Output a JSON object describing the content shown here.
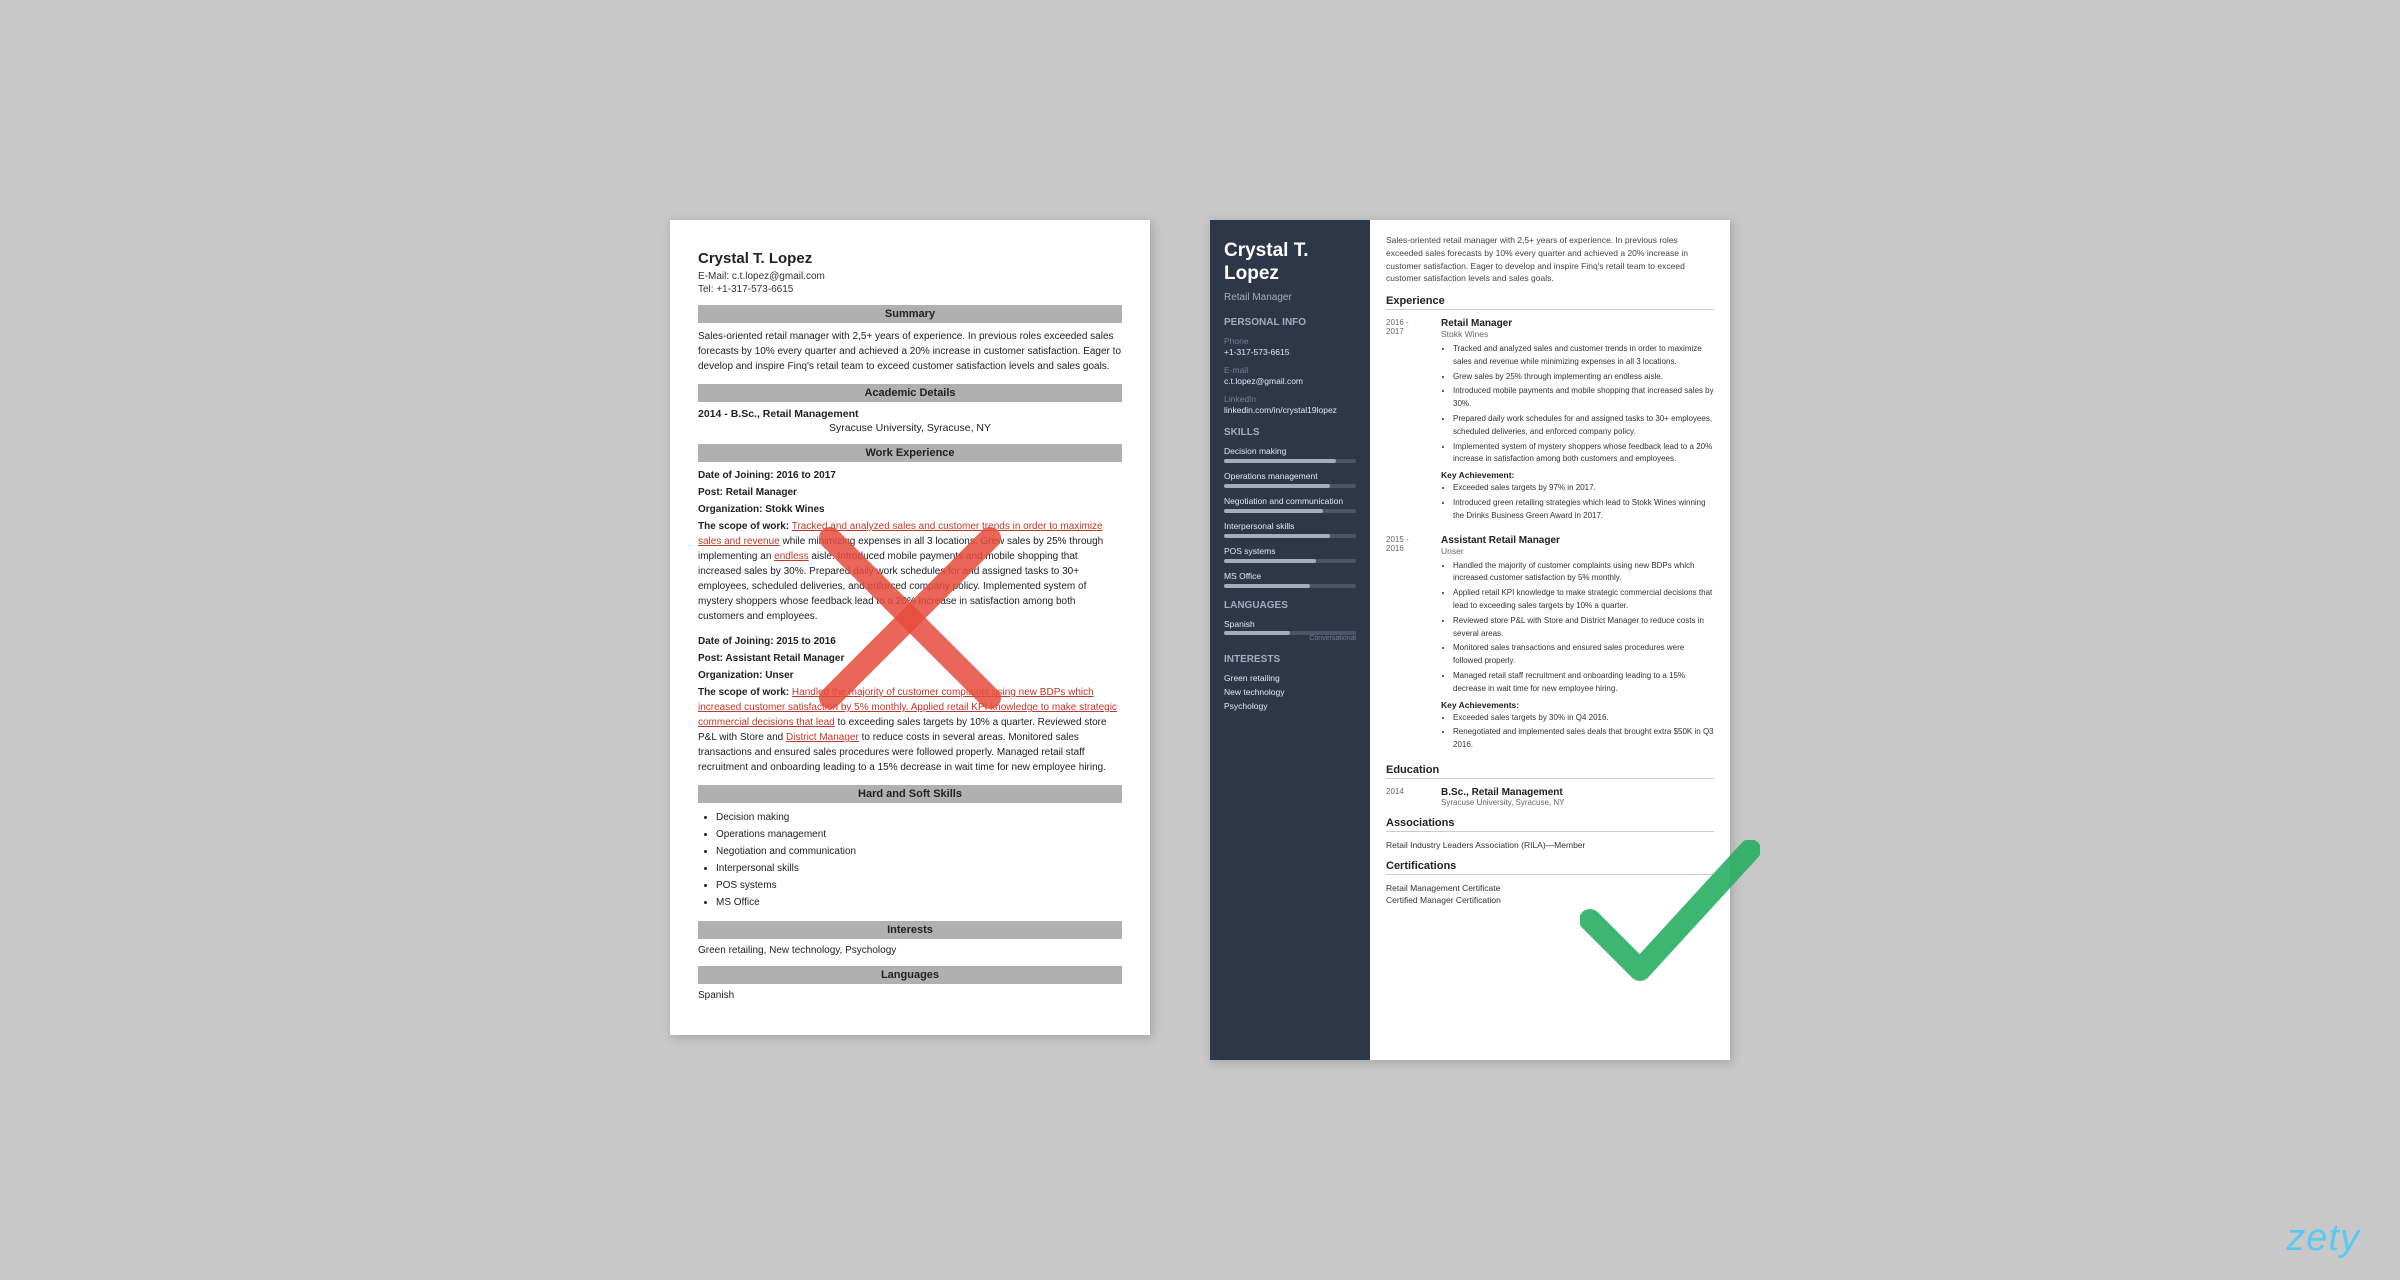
{
  "left_resume": {
    "name": "Crystal T. Lopez",
    "email_label": "E-Mail:",
    "email": "c.t.lopez@gmail.com",
    "tel_label": "Tel:",
    "tel": "+1-317-573-6615",
    "sections": {
      "summary": {
        "title": "Summary",
        "text": "Sales-oriented retail manager with 2,5+ years of experience. In previous roles exceeded sales forecasts by 10% every quarter and achieved a 20% increase in customer satisfaction. Eager to develop and inspire Finq's retail team to exceed customer satisfaction levels and sales goals."
      },
      "academic": {
        "title": "Academic Details",
        "degree": "2014 - B.Sc., Retail Management",
        "school": "Syracuse University, Syracuse, NY"
      },
      "work": {
        "title": "Work Experience",
        "jobs": [
          {
            "dates": "Date of Joining: 2016 to 2017",
            "post": "Post: Retail Manager",
            "org": "Organization: Stokk Wines",
            "scope_label": "The scope of work:",
            "scope": "Tracked and analyzed sales and customer trends in order to maximize sales and revenue while minimizing expenses in all 3 locations. Grew sales by 25% through implementing an endless aisle. Introduced mobile payments and mobile shopping that increased sales by 30%. Prepared daily work schedules for and assigned tasks to 30+ employees, scheduled deliveries, and enforced company policy. Implemented system of mystery shoppers whose feedback lead to a 20% increase in satisfaction among both customers and employees."
          },
          {
            "dates": "Date of Joining: 2015 to 2016",
            "post": "Post: Assistant Retail Manager",
            "org": "Organization: Unser",
            "scope_label": "The scope of work:",
            "scope": "Handled the majority of customer complaints using new BDPs which increased customer satisfaction by 5% monthly. Applied retail KPI knowledge to make strategic commercial decisions that lead to exceeding sales targets by 10% a quarter. Reviewed store P&L with Store and District Manager to reduce costs in several areas. Monitored sales transactions and ensured sales procedures were followed properly. Managed retail staff recruitment and onboarding leading to a 15% decrease in wait time for new employee hiring."
          }
        ]
      },
      "skills": {
        "title": "Hard and Soft Skills",
        "items": [
          "Decision making",
          "Operations management",
          "Negotiation and communication",
          "Interpersonal skills",
          "POS systems",
          "MS Office"
        ]
      },
      "interests": {
        "title": "Interests",
        "text": "Green retailing, New technology, Psychology"
      },
      "languages": {
        "title": "Languages",
        "text": "Spanish"
      }
    }
  },
  "right_resume": {
    "name_line1": "Crystal T.",
    "name_line2": "Lopez",
    "title": "Retail Manager",
    "sidebar": {
      "personal_info_title": "Personal Info",
      "phone_label": "Phone",
      "phone": "+1-317-573-6615",
      "email_label": "E-mail",
      "email": "c.t.lopez@gmail.com",
      "linkedin_label": "LinkedIn",
      "linkedin": "linkedin.com/in/crystal19lopez",
      "skills_title": "Skills",
      "skills": [
        {
          "name": "Decision making",
          "pct": 85
        },
        {
          "name": "Operations management",
          "pct": 80
        },
        {
          "name": "Negotiation and communication",
          "pct": 75
        },
        {
          "name": "Interpersonal skills",
          "pct": 80
        },
        {
          "name": "POS systems",
          "pct": 70
        },
        {
          "name": "MS Office",
          "pct": 65
        }
      ],
      "languages_title": "Languages",
      "languages": [
        {
          "name": "Spanish",
          "pct": 50,
          "level": "Conversational"
        }
      ],
      "interests_title": "Interests",
      "interests": [
        "Green retailing",
        "New technology",
        "Psychology"
      ]
    },
    "main": {
      "summary": "Sales-oriented retail manager with 2,5+ years of experience. In previous roles exceeded sales forecasts by 10% every quarter and achieved a 20% increase in customer satisfaction. Eager to develop and inspire Finq's retail team to exceed customer satisfaction levels and sales goals.",
      "experience_title": "Experience",
      "jobs": [
        {
          "date_start": "2016 -",
          "date_end": "2017",
          "title": "Retail Manager",
          "company": "Stokk Wines",
          "bullets": [
            "Tracked and analyzed sales and customer trends in order to maximize sales and revenue while minimizing expenses in all 3 locations.",
            "Grew sales by 25% through implementing an endless aisle.",
            "Introduced mobile payments and mobile shopping that increased sales by 30%.",
            "Prepared daily work schedules for and assigned tasks to 30+ employees, scheduled deliveries, and enforced company policy.",
            "Implemented system of mystery shoppers whose feedback lead to a 20% increase in satisfaction among both customers and employees."
          ],
          "key_achievement_label": "Key Achievement:",
          "key_achievements": [
            "Exceeded sales targets by 97% in 2017.",
            "Introduced green retailing strategies which lead to Stokk Wines winning the Drinks Business Green Award in 2017."
          ]
        },
        {
          "date_start": "2015 -",
          "date_end": "2016",
          "title": "Assistant Retail Manager",
          "company": "Unser",
          "bullets": [
            "Handled the majority of customer complaints using new BDPs which increased customer satisfaction by 5% monthly.",
            "Applied retail KPI knowledge to make strategic commercial decisions that lead to exceeding sales targets by 10% a quarter.",
            "Reviewed store P&L with Store and District Manager to reduce costs in several areas.",
            "Monitored sales transactions and ensured sales procedures were followed properly.",
            "Managed retail staff recruitment and onboarding leading to a 15% decrease in wait time for new employee hiring."
          ],
          "key_achievement_label": "Key Achievements:",
          "key_achievements": [
            "Exceeded sales targets by 30% in Q4 2016.",
            "Renegotiated and implemented sales deals that brought extra $50K in Q3 2016."
          ]
        }
      ],
      "education_title": "Education",
      "education": [
        {
          "year": "2014",
          "degree": "B.Sc., Retail Management",
          "school": "Syracuse University, Syracuse, NY"
        }
      ],
      "associations_title": "Associations",
      "associations": [
        "Retail Industry Leaders Association (RILA)—Member"
      ],
      "certifications_title": "Certifications",
      "certifications": [
        "Retail Management Certificate",
        "Certified Manager Certification"
      ]
    }
  },
  "branding": {
    "zety_logo": "zety"
  }
}
